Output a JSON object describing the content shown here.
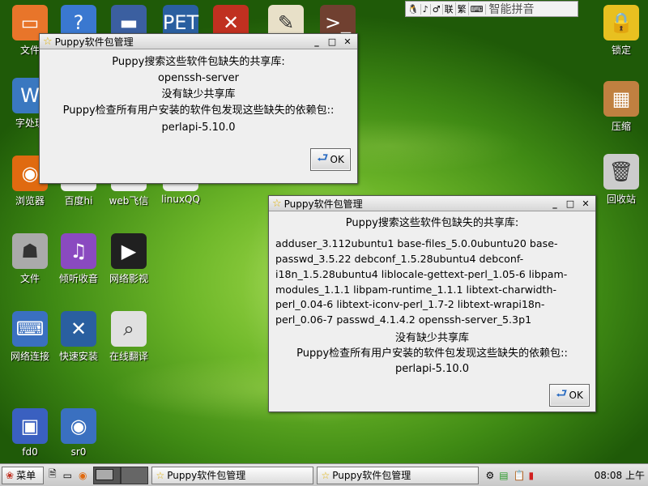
{
  "desktop_icons": [
    {
      "label": "文件",
      "icon": "folder-icon",
      "color": "#e8752a",
      "glyph": "▭"
    },
    {
      "label": "",
      "icon": "help-icon",
      "color": "#3a78d0",
      "glyph": "?"
    },
    {
      "label": "",
      "icon": "drive-icon",
      "color": "#3b5fa0",
      "glyph": "▬"
    },
    {
      "label": "",
      "icon": "pet-package-icon",
      "color": "#2a5fa0",
      "glyph": "PET"
    },
    {
      "label": "",
      "icon": "tools-icon",
      "color": "#c03020",
      "glyph": "✕"
    },
    {
      "label": "",
      "icon": "editor-icon",
      "color": "#e8e0c8",
      "glyph": "✎"
    },
    {
      "label": "",
      "icon": "terminal-icon",
      "color": "#704030",
      "glyph": ">_"
    },
    {
      "label": "字处理",
      "icon": "word-processor-icon",
      "color": "#3a78c0",
      "glyph": "W"
    },
    {
      "label": "浏览器",
      "icon": "firefox-icon",
      "color": "#e06a10",
      "glyph": "◉"
    },
    {
      "label": "百度hi",
      "icon": "baidu-hi-icon",
      "color": "#eeeeee",
      "glyph": "☺"
    },
    {
      "label": "web飞信",
      "icon": "web-fetion-icon",
      "color": "#eeeeee",
      "glyph": "☺"
    },
    {
      "label": "linuxQQ",
      "icon": "qq-icon",
      "color": "#eeeeee",
      "glyph": "☺"
    },
    {
      "label": "文件",
      "icon": "file-manager-icon",
      "color": "#aaaaaa",
      "glyph": "☗"
    },
    {
      "label": "倾听收音",
      "icon": "radio-icon",
      "color": "#8a4ac0",
      "glyph": "♫"
    },
    {
      "label": "网络影视",
      "icon": "video-icon",
      "color": "#202020",
      "glyph": "▶"
    },
    {
      "label": "网络连接",
      "icon": "network-icon",
      "color": "#3a70c0",
      "glyph": "⌨"
    },
    {
      "label": "快速安装",
      "icon": "quick-install-icon",
      "color": "#2a5fa0",
      "glyph": "✕"
    },
    {
      "label": "在线翻译",
      "icon": "translate-icon",
      "color": "#e0e0e0",
      "glyph": "⌕"
    },
    {
      "label": "fd0",
      "icon": "floppy-icon",
      "color": "#3a60c0",
      "glyph": "▣"
    },
    {
      "label": "sr0",
      "icon": "cdrom-icon",
      "color": "#3a70c0",
      "glyph": "◉"
    },
    {
      "label": "锁定",
      "icon": "lock-icon",
      "color": "#e8c020",
      "glyph": "🔒"
    },
    {
      "label": "压缩",
      "icon": "archive-icon",
      "color": "#c08040",
      "glyph": "▦"
    },
    {
      "label": "回收站",
      "icon": "trash-icon",
      "color": "#cccccc",
      "glyph": "🗑"
    }
  ],
  "topbar": {
    "items": [
      "🐧",
      "♪",
      "♂",
      "联",
      "繁",
      "⌨"
    ],
    "ime_label": "智能拼音"
  },
  "dialog1": {
    "title": "Puppy软件包管理",
    "line1": "Puppy搜索这些软件包缺失的共享库:",
    "line2": "openssh-server",
    "line3": "没有缺少共享库",
    "line4": "Puppy检查所有用户安装的软件包发现这些缺失的依赖包::",
    "line5": "perlapi-5.10.0",
    "ok": "OK"
  },
  "dialog2": {
    "title": "Puppy软件包管理",
    "line1": "Puppy搜索这些软件包缺失的共享库:",
    "deps_lines": [
      "adduser_3.112ubuntu1 base-files_5.0.0ubuntu20 base-",
      "passwd_3.5.22 debconf_1.5.28ubuntu4 debconf-",
      "i18n_1.5.28ubuntu4 liblocale-gettext-perl_1.05-6 libpam-",
      "modules_1.1.1 libpam-runtime_1.1.1 libtext-charwidth-",
      "perl_0.04-6 libtext-iconv-perl_1.7-2 libtext-wrapi18n-",
      "perl_0.06-7 passwd_4.1.4.2 openssh-server_5.3p1"
    ],
    "line3": "没有缺少共享库",
    "line4": "Puppy检查所有用户安装的软件包发现这些缺失的依赖包::",
    "line5": "perlapi-5.10.0",
    "ok": "OK"
  },
  "taskbar": {
    "menu": "菜单",
    "tasks": [
      "Puppy软件包管理",
      "Puppy软件包管理"
    ],
    "clock": "08:08 上午"
  }
}
